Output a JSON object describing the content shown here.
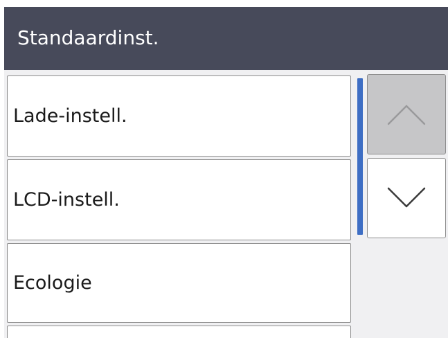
{
  "header": {
    "title": "Standaardinst."
  },
  "menu": {
    "items": [
      {
        "label": "Lade-instell."
      },
      {
        "label": "LCD-instell."
      },
      {
        "label": "Ecologie"
      },
      {
        "label": ""
      }
    ]
  },
  "scroll": {
    "up_icon": "chevron-up-icon",
    "down_icon": "chevron-down-icon",
    "up_enabled": false,
    "down_enabled": true
  },
  "colors": {
    "header_bg": "#474a5a",
    "scroll_indicator": "#3e6ec4",
    "disabled_button": "#c6c6c8"
  }
}
